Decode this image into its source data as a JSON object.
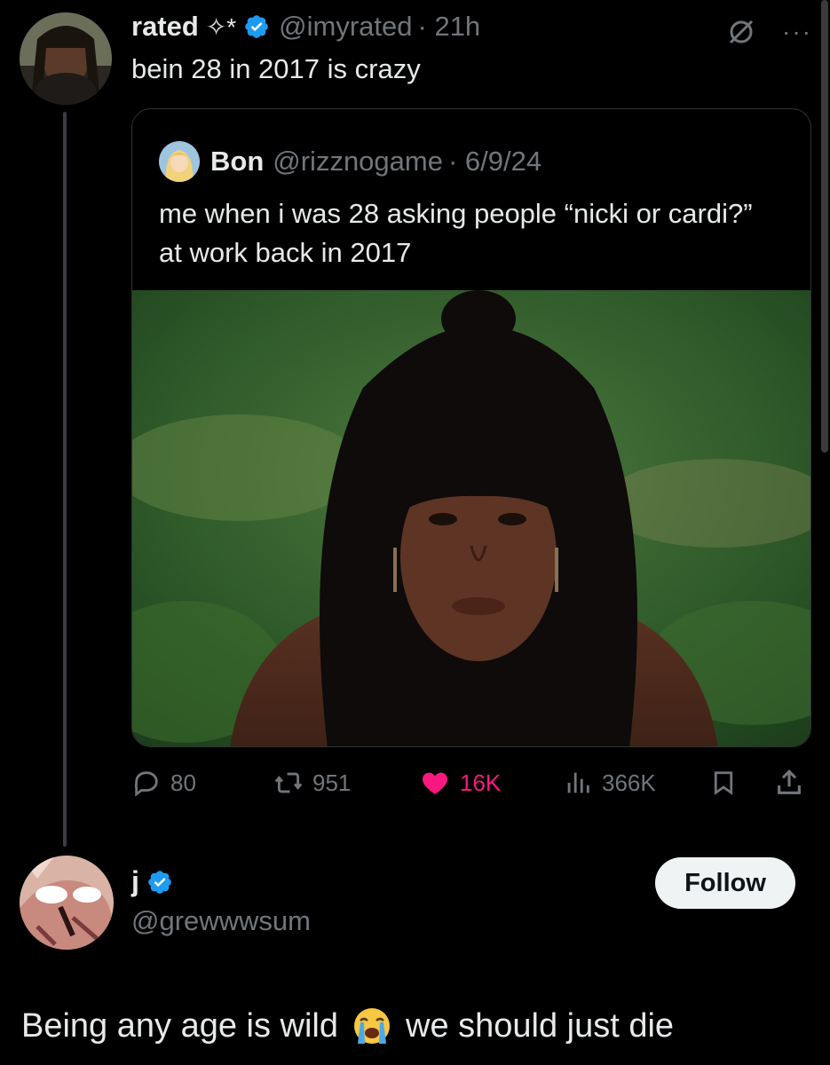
{
  "tweet": {
    "author_name": "rated",
    "author_suffix": "✧*",
    "handle": "@imyrated",
    "time": "· 21h",
    "text": "bein 28 in 2017 is crazy",
    "icons": [
      "avatar",
      "verified-badge-icon",
      "grok-icon",
      "more-icon"
    ]
  },
  "quote": {
    "author_name": "Bon",
    "handle": "@rizznogame",
    "date": "· 6/9/24",
    "text": "me when i was 28 asking people “nicki or cardi?” at work back in 2017",
    "media_alt": "photo-woman-with-black-bangs-green-background"
  },
  "actions": {
    "replies": "80",
    "reposts": "951",
    "likes": "16K",
    "views": "366K",
    "like_color": "#f91880",
    "icons": [
      "reply-icon",
      "repost-icon",
      "heart-icon",
      "views-icon",
      "bookmark-icon",
      "share-icon"
    ]
  },
  "reply": {
    "author_name": "j",
    "handle": "@grewwwsum",
    "follow_label": "Follow",
    "text_before": "Being any age is wild",
    "emoji": "😭",
    "text_after": "we should just die"
  },
  "colors": {
    "background": "#000000",
    "text": "#e7e9ea",
    "muted": "#71767b",
    "verified": "#1d9bf0",
    "like": "#f91880"
  }
}
